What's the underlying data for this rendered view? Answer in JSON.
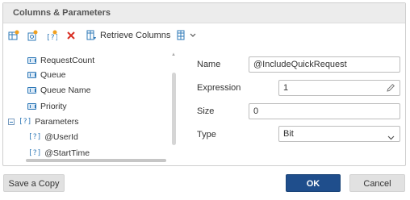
{
  "panel": {
    "title": "Columns & Parameters"
  },
  "toolbar": {
    "add_column_icon": "add-column-icon",
    "add_calculated_icon": "add-calculated-column-icon",
    "add_parameter_icon": "add-parameter-icon",
    "delete_icon": "delete-icon",
    "retrieve_label": "Retrieve Columns",
    "grid_menu_icon": "grid-dropdown-icon"
  },
  "tree": {
    "columns": [
      {
        "label": "RequestCount"
      },
      {
        "label": "Queue"
      },
      {
        "label": "Queue Name"
      },
      {
        "label": "Priority"
      }
    ],
    "parameters_group": {
      "label": "Parameters",
      "icon_text": "[?]"
    },
    "parameters": [
      {
        "label": "@UserId",
        "icon_text": "[?]"
      },
      {
        "label": "@StartTime",
        "icon_text": "[?]"
      }
    ]
  },
  "form": {
    "name_label": "Name",
    "name_value": "@IncludeQuickRequest",
    "expression_label": "Expression",
    "expression_value": "1",
    "size_label": "Size",
    "size_value": "0",
    "type_label": "Type",
    "type_value": "Bit"
  },
  "footer": {
    "save_copy_label": "Save a Copy",
    "ok_label": "OK",
    "cancel_label": "Cancel"
  },
  "colors": {
    "primary_button": "#1f4e8c",
    "delete_red": "#d93025",
    "icon_blue": "#2e78b7"
  }
}
